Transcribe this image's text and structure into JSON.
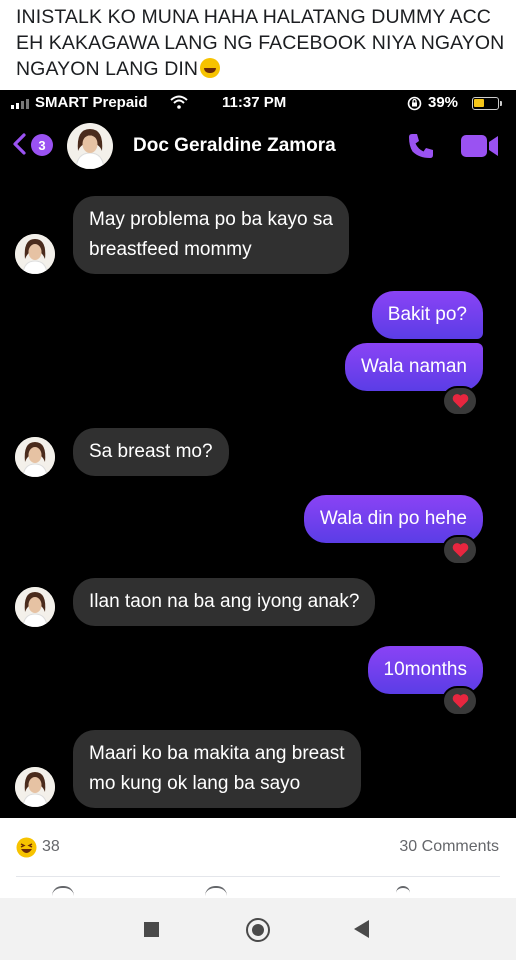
{
  "post": {
    "caption": "INISTALK KO MUNA HAHA HALATANG DUMMY ACC EH KAKAGAWA LANG NG FACEBOOK NIYA NGAYON NGAYON LANG DIN",
    "caption_emoji": "rofl-emoji",
    "reaction_count": "38",
    "comments_label": "30 Comments"
  },
  "status_bar": {
    "carrier": "SMART Prepaid",
    "time": "11:37 PM",
    "battery": "39%"
  },
  "chat_header": {
    "unread_badge": "3",
    "contact_name": "Doc Geraldine Zamora"
  },
  "messages": [
    {
      "from": "them",
      "lines": [
        "May problema po ba kayo sa",
        "breastfeed mommy"
      ]
    },
    {
      "from": "me",
      "text": "Bakit po?"
    },
    {
      "from": "me",
      "text": "Wala naman",
      "reaction": "heart"
    },
    {
      "from": "them",
      "text": "Sa breast mo?"
    },
    {
      "from": "me",
      "text": "Wala din po hehe",
      "reaction": "heart"
    },
    {
      "from": "them",
      "text": "Ilan taon na ba ang iyong anak?"
    },
    {
      "from": "me",
      "text": "10months",
      "reaction": "heart"
    },
    {
      "from": "them",
      "lines": [
        "Maari ko ba makita ang breast",
        "mo kung ok lang ba sayo"
      ]
    }
  ],
  "colors": {
    "outgoing_bubble": "#7b3ff2",
    "incoming_bubble": "#303030",
    "accent": "#9a52f2",
    "heart": "#e8263f"
  }
}
